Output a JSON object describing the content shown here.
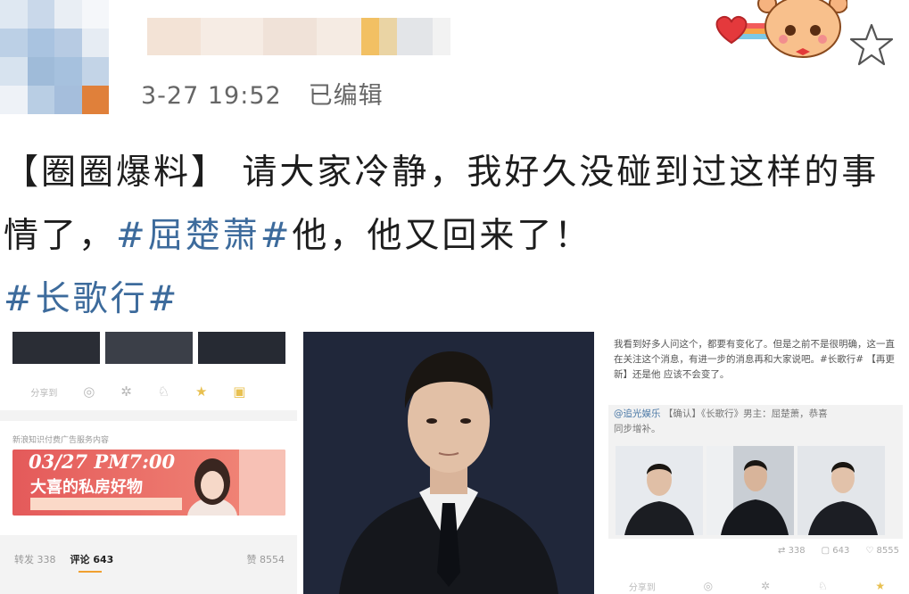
{
  "header": {
    "timestamp": "3-27 19:52",
    "edited_label": "已编辑"
  },
  "post": {
    "text_prefix": "【圈圈爆料】 请大家冷静，我好久没碰到过这样的事情了，",
    "hashtag_1": "#屈楚萧#",
    "text_middle": "他，他又回来了！",
    "hashtag_2": "#长歌行#"
  },
  "left_screenshot": {
    "share_label": "分享到",
    "ad_header": "新浪知识付费广告服务内容",
    "ad_date": "03/27 PM7:00",
    "ad_title": "大喜的私房好物",
    "tab_repost": "转发 338",
    "tab_comment": "评论 643",
    "tab_like": "赞 8554"
  },
  "right_screenshot": {
    "body_text": "我看到好多人问这个，都要有变化了。但是之前不是很明确，这一直在关注这个消息，有进一步的消息再和大家说吧。#长歌行# 【再更新】还是他 应该不会变了。",
    "quote_source": "@追光娱乐",
    "quote_text": "【确认】《长歌行》男主：屈楚萧，恭喜",
    "quote_text_2": "同步增补。",
    "stat_repost": "338",
    "stat_comment": "643",
    "stat_like": "8555",
    "share_label": "分享到"
  },
  "colors": {
    "hashtag": "#3d6b9c",
    "text": "#1d1d1d",
    "timestamp": "#666666",
    "ad_red": "#e45a5a",
    "photo_bg": "#1f2536"
  },
  "icons": [
    "heart-icon",
    "bear-badge-icon",
    "star-icon",
    "comment-icon",
    "like-icon",
    "share-icon"
  ]
}
